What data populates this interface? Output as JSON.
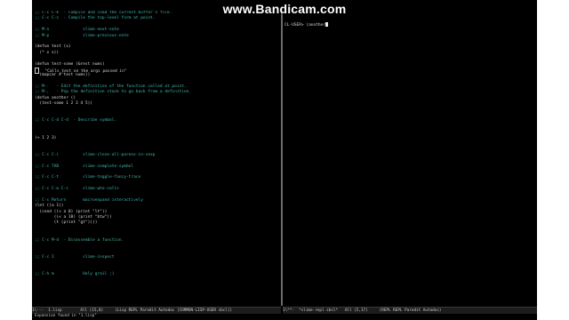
{
  "watermark": "www.Bandicam.com",
  "editor": {
    "left_lines": [
      {
        "t": ";; C-c C-k  - Compile and load the current buffer's file.",
        "c": "comment"
      },
      {
        "t": ";; C-c C-c  - Compile the top-level form at point.",
        "c": "comment"
      },
      {
        "t": "",
        "c": "code"
      },
      {
        "t": ";; M-n              slime-next-note",
        "c": "comment"
      },
      {
        "t": ";; M-p              slime-previous-note",
        "c": "comment"
      },
      {
        "t": "",
        "c": "code"
      },
      {
        "t": "(defun test (x)",
        "c": "code"
      },
      {
        "t": "  (* x x))",
        "c": "code"
      },
      {
        "t": "",
        "c": "code"
      },
      {
        "t": "(defun test-some (&rest nums)",
        "c": "code"
      },
      {
        "t": "  \"Calls test on the args passed in\"",
        "c": "code",
        "cursor": true
      },
      {
        "t": "  (mapcar #'test nums))",
        "c": "code"
      },
      {
        "t": "",
        "c": "code"
      },
      {
        "t": ";; M-.   - Edit the definition of the function called at point.",
        "c": "comment"
      },
      {
        "t": ";; M-,   - Pop the definition stack to go back from a definition.",
        "c": "comment"
      },
      {
        "t": "(defun another ()",
        "c": "code"
      },
      {
        "t": "  (test-some 1 2 3 4 5))",
        "c": "code"
      },
      {
        "t": "",
        "c": "code"
      },
      {
        "t": "",
        "c": "code"
      },
      {
        "t": ";; C-c C-d C-d  - Describe symbol.",
        "c": "comment"
      },
      {
        "t": "",
        "c": "code"
      },
      {
        "t": "",
        "c": "code"
      },
      {
        "t": "(+ 1 2 3)",
        "c": "code"
      },
      {
        "t": "",
        "c": "code"
      },
      {
        "t": "",
        "c": "code"
      },
      {
        "t": ";; C-c C-)          slime-close-all-parens-in-sexp",
        "c": "comment"
      },
      {
        "t": "",
        "c": "code"
      },
      {
        "t": ";; C-c TAB          slime-complete-symbol",
        "c": "comment"
      },
      {
        "t": "",
        "c": "code"
      },
      {
        "t": ";; C-c C-t          slime-toggle-fancy-trace",
        "c": "comment"
      },
      {
        "t": "",
        "c": "code"
      },
      {
        "t": ";; C-c C-w C-c      slime-who-calls",
        "c": "comment"
      },
      {
        "t": "",
        "c": "code"
      },
      {
        "t": ";; C-c Return       macroexpand interactively",
        "c": "comment"
      },
      {
        "t": "(let ((a 1))",
        "c": "code"
      },
      {
        "t": "  (cond ((< a 0) (print \"lt\"))",
        "c": "code"
      },
      {
        "t": "        ((< a 10) (print \"btw\"))",
        "c": "code"
      },
      {
        "t": "        (t (print \"gt\"))))",
        "c": "code"
      },
      {
        "t": "",
        "c": "code"
      },
      {
        "t": "",
        "c": "code"
      },
      {
        "t": ";; C-c M-d  - Disassemble a function.",
        "c": "comment"
      },
      {
        "t": "",
        "c": "code"
      },
      {
        "t": "",
        "c": "code"
      },
      {
        "t": ";; C-c I            slime-inspect",
        "c": "comment"
      },
      {
        "t": "",
        "c": "code"
      },
      {
        "t": "",
        "c": "code"
      },
      {
        "t": ";; C-h m            Holy grail ;)",
        "c": "comment"
      }
    ],
    "repl_prompt": "CL-USER> (another",
    "modeline_left": "1\\---  1.lisp        All (15,0)     (Lisp REPL Paredit Autodoc [COMMON-LISP-USER sbcl])",
    "modeline_right": "1\\**-  *slime-repl sbcl*   All (5,17)     (REPL REPL Paredit Autodoc)",
    "minibuffer": "Expansion found in \"1.lisp\""
  }
}
